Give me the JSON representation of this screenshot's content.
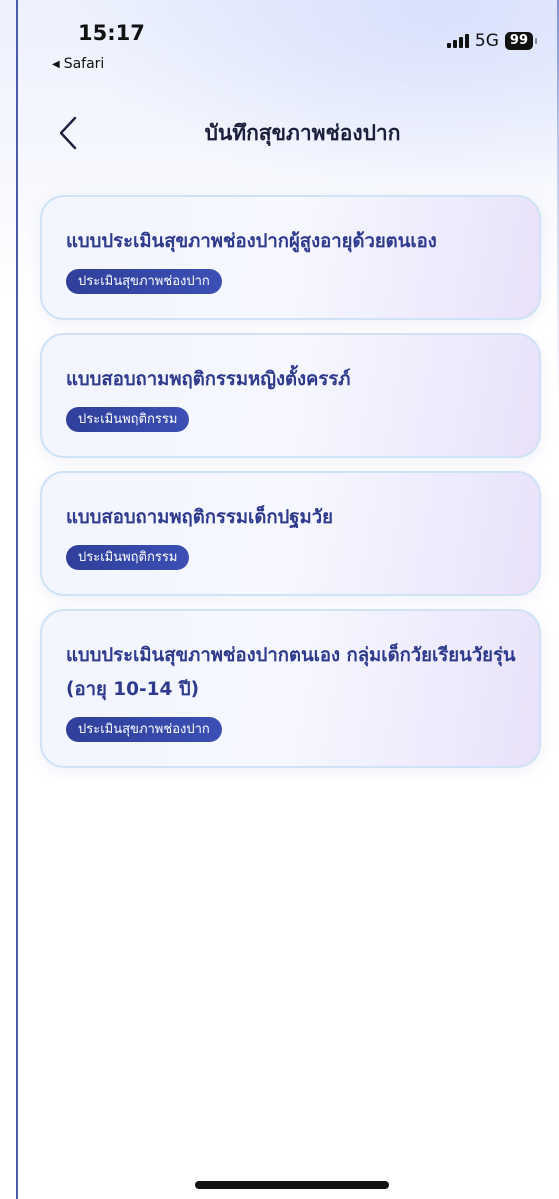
{
  "status_bar": {
    "time": "15:17",
    "back_app": "Safari",
    "network": "5G",
    "battery": "99"
  },
  "nav": {
    "title": "บันทึกสุขภาพช่องปาก",
    "back_icon": "chevron-left-icon"
  },
  "forms": [
    {
      "title": "แบบประเมินสุขภาพช่องปากผู้สูงอายุด้วยตนเอง",
      "tag": "ประเมินสุขภาพช่องปาก"
    },
    {
      "title": "แบบสอบถามพฤติกรรมหญิงตั้งครรภ์",
      "tag": "ประเมินพฤติกรรม"
    },
    {
      "title": "แบบสอบถามพฤติกรรมเด็กปฐมวัย",
      "tag": "ประเมินพฤติกรรม"
    },
    {
      "title": "แบบประเมินสุขภาพช่องปากตนเอง กลุ่มเด็กวัยเรียนวัยรุ่น (อายุ 10-14 ปี)",
      "tag": "ประเมินสุขภาพช่องปาก"
    }
  ],
  "colors": {
    "accent": "#2e3a8c",
    "tag_bg": "#3344a6",
    "card_border": "#cfe2f6"
  }
}
